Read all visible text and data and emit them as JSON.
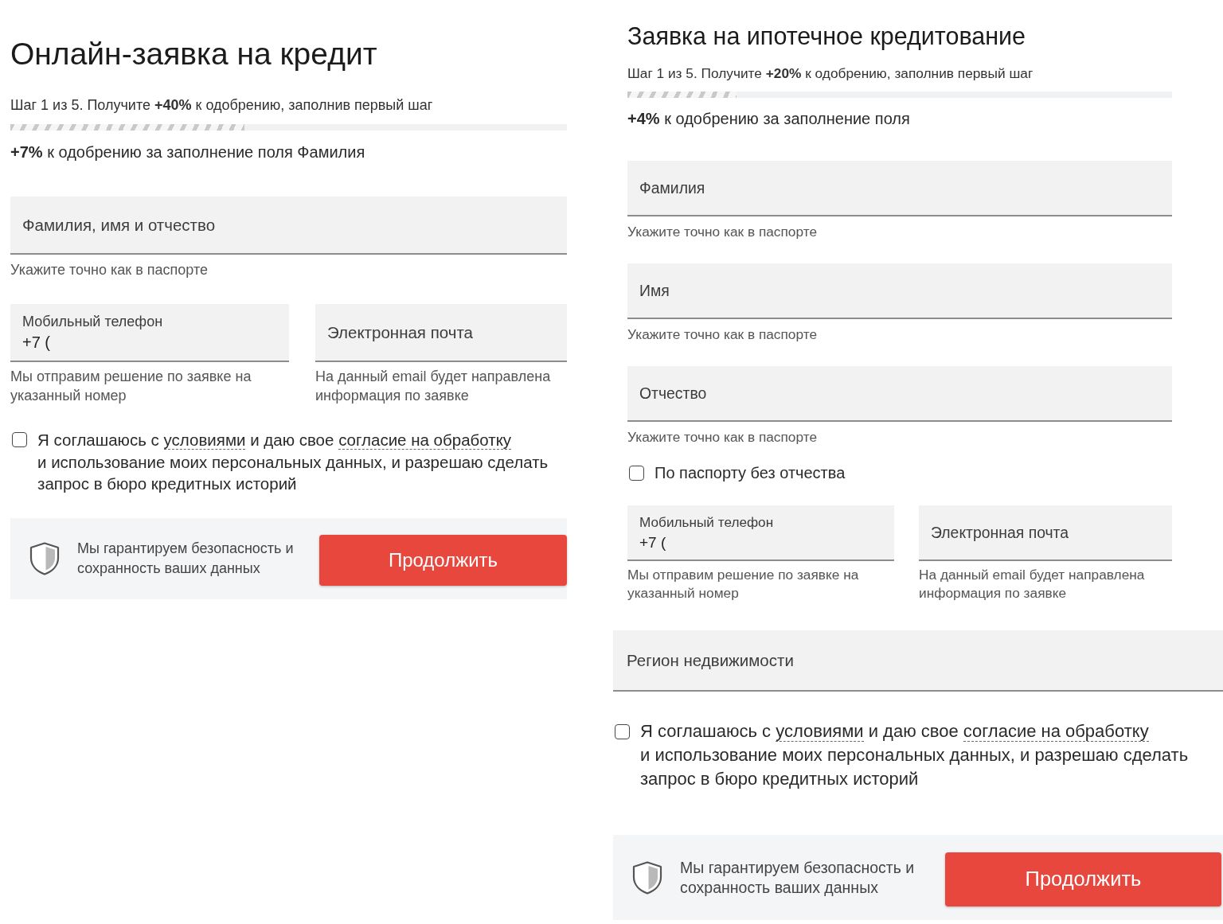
{
  "forms": [
    {
      "title": "Онлайн-заявка на кредит",
      "step_text": "Шаг 1 из 5. Получите **+40%** к одобрению, заполнив первый шаг",
      "progress": {
        "level": 0.42
      },
      "bonus_text": "**+7%** к одобрению за заполнение поля Фамилия",
      "rows": [
        {
          "kind": "field",
          "placeholder": "Фамилия, имя и отчество",
          "hint": "Укажите точно как в паспорте"
        },
        {
          "kind": "pair",
          "fields": [
            {
              "label": "Мобильный телефон",
              "value": "+7 (",
              "hint": "Мы отправим решение по заявке на указанный номер"
            },
            {
              "placeholder": "Электронная почта",
              "hint": "На данный email будет направлена информация по заявке"
            }
          ]
        }
      ],
      "consent": {
        "checked": false,
        "lines": [
          [
            {
              "kind": "text",
              "text": "Я соглашаюсь с "
            },
            {
              "kind": "link",
              "text": "условиями"
            },
            {
              "kind": "text",
              "text": " и даю свое "
            },
            {
              "kind": "link",
              "text": "согласие на обработку"
            }
          ],
          [
            {
              "kind": "text",
              "text": "и использование моих персональных данных, и разрешаю сделать запрос в бюро кредитных историй"
            }
          ]
        ]
      },
      "footer": {
        "note": "Мы гарантируем безопасность и сохранность ваших данных",
        "button": "Продолжить"
      }
    },
    {
      "title": "Заявка на ипотечное кредитование",
      "step_text": "Шаг 1 из 5. Получите **+20%** к одобрению, заполнив первый шаг",
      "progress": {
        "level": 0.2
      },
      "bonus_text": "**+4%** к одобрению за заполнение поля",
      "rows": [
        {
          "kind": "field",
          "placeholder": "Фамилия",
          "hint": "Укажите точно как в паспорте"
        },
        {
          "kind": "field",
          "placeholder": "Имя",
          "hint": "Укажите точно как в паспорте"
        },
        {
          "kind": "field",
          "placeholder": "Отчество",
          "hint": "Укажите точно как в паспорте"
        },
        {
          "kind": "checkbox",
          "label": "По паспорту без отчества",
          "checked": false
        },
        {
          "kind": "pair",
          "fields": [
            {
              "label": "Мобильный телефон",
              "value": "+7 (",
              "hint": "Мы отправим решение по заявке на указанный номер"
            },
            {
              "placeholder": "Электронная почта",
              "hint": "На данный email будет направлена информация по заявке"
            }
          ]
        }
      ],
      "region_field": {
        "placeholder": "Регион недвижимости"
      },
      "consent": {
        "checked": false,
        "lines": [
          [
            {
              "kind": "text",
              "text": "Я соглашаюсь с "
            },
            {
              "kind": "link",
              "text": "условиями"
            },
            {
              "kind": "text",
              "text": " и даю свое "
            },
            {
              "kind": "link",
              "text": "согласие на обработку"
            }
          ],
          [
            {
              "kind": "text",
              "text": "и использование моих персональных данных, и разрешаю сделать запрос в бюро кредитных историй"
            }
          ]
        ]
      },
      "footer": {
        "note": "Мы гарантируем безопасность и сохранность ваших данных",
        "button": "Продолжить"
      }
    }
  ]
}
